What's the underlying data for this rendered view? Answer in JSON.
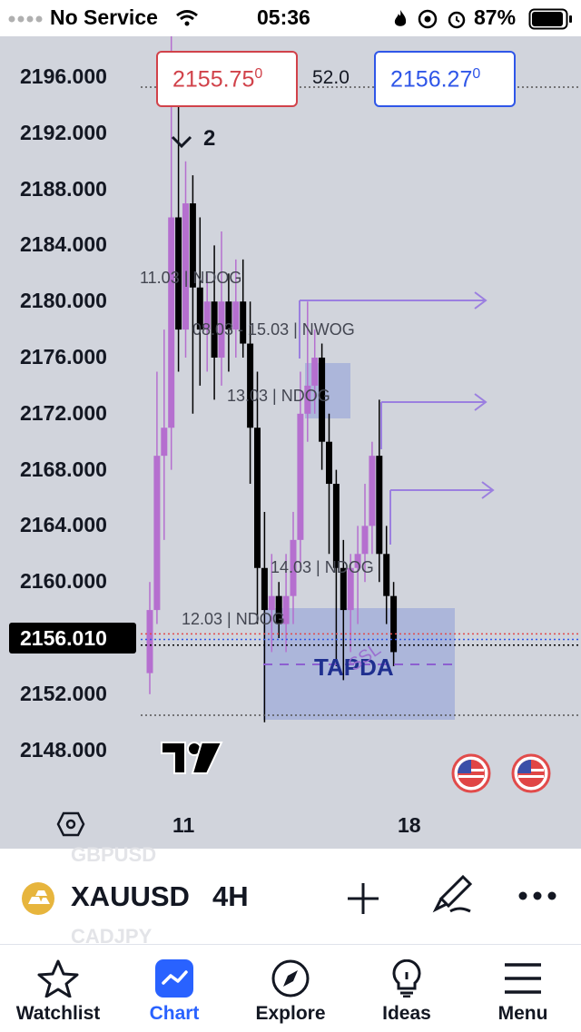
{
  "status": {
    "carrier": "No Service",
    "time": "05:36",
    "battery": "87%"
  },
  "chart": {
    "bid": "2155.75",
    "bid_sup": "0",
    "spread": "52.0",
    "ask": "2156.27",
    "ask_sup": "0",
    "bars_back": "2",
    "price_labels": [
      "2196.000",
      "2192.000",
      "2188.000",
      "2184.000",
      "2180.000",
      "2176.000",
      "2172.000",
      "2168.000",
      "2164.000",
      "2160.000",
      "2152.000",
      "2148.000"
    ],
    "current_price": "2156.010",
    "annotations": {
      "ndog_a": "11.03 | NDOG",
      "nwog": "08.03 - 15.03 | NWOG",
      "ndog_b": "13.03 | NDOG",
      "ndog_c": "14.03 | NDOG",
      "ndog_d": "12.03 | NDOG",
      "tapda": "TAPDA",
      "ssl": "SSL"
    },
    "x_labels": [
      "11",
      "18"
    ],
    "colors": {
      "bull": "#b56fcf",
      "bear": "#000000",
      "zone": "#7e93d6",
      "arrow": "#9b7fe0"
    }
  },
  "ghost_symbols": [
    "GBPUSD",
    "CADJPY"
  ],
  "symbol": {
    "name": "XAUUSD",
    "interval": "4H"
  },
  "tabs": [
    {
      "label": "Watchlist",
      "icon": "star-icon"
    },
    {
      "label": "Chart",
      "icon": "chart-icon",
      "active": true
    },
    {
      "label": "Explore",
      "icon": "compass-icon"
    },
    {
      "label": "Ideas",
      "icon": "lightbulb-icon"
    },
    {
      "label": "Menu",
      "icon": "menu-icon"
    }
  ]
}
